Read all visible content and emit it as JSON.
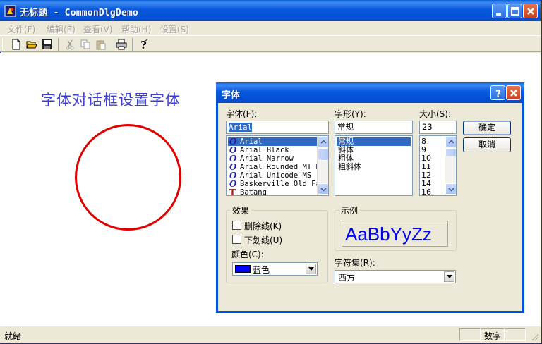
{
  "window": {
    "title": "无标题 - CommonDlgDemo"
  },
  "menu": [
    "文件(F)",
    "编辑(E)",
    "查看(V)",
    "帮助(H)",
    "设置(S)"
  ],
  "toolbar": {
    "icons": [
      "new-file-icon",
      "open-folder-icon",
      "save-icon",
      "cut-icon",
      "copy-icon",
      "paste-icon",
      "print-icon",
      "help-icon"
    ]
  },
  "canvas": {
    "text": "字体对话框设置字体",
    "text_color": "#3c3cd0",
    "circle_color": "#e00000"
  },
  "status": {
    "text": "就绪",
    "panes": [
      "",
      "数字",
      ""
    ]
  },
  "font_dialog": {
    "title": "字体",
    "font_label": "字体(F):",
    "font_value": "Arial",
    "fonts": [
      {
        "name": "Arial",
        "type": "O",
        "selected": true
      },
      {
        "name": "Arial Black",
        "type": "O",
        "selected": false
      },
      {
        "name": "Arial Narrow",
        "type": "O",
        "selected": false
      },
      {
        "name": "Arial Rounded MT B",
        "type": "O",
        "selected": false
      },
      {
        "name": "Arial Unicode MS",
        "type": "O",
        "selected": false
      },
      {
        "name": "Baskerville Old Fa",
        "type": "O",
        "selected": false
      },
      {
        "name": "Batang",
        "type": "T",
        "selected": false
      }
    ],
    "style_label": "字形(Y):",
    "style_value": "常规",
    "styles": [
      {
        "name": "常规",
        "selected": true
      },
      {
        "name": "斜体",
        "selected": false
      },
      {
        "name": "粗体",
        "selected": false
      },
      {
        "name": "粗斜体",
        "selected": false
      }
    ],
    "size_label": "大小(S):",
    "size_value": "23",
    "sizes": [
      {
        "name": "8"
      },
      {
        "name": "9"
      },
      {
        "name": "10"
      },
      {
        "name": "11"
      },
      {
        "name": "12"
      },
      {
        "name": "14"
      },
      {
        "name": "16"
      }
    ],
    "ok_label": "确定",
    "cancel_label": "取消",
    "effects_title": "效果",
    "strikeout_label": "删除线(K)",
    "underline_label": "下划线(U)",
    "color_label": "颜色(C):",
    "color_value": "蓝色",
    "color_swatch": "#0000ff",
    "sample_title": "示例",
    "sample_text": "AaBbYyZz",
    "charset_label": "字符集(R):",
    "charset_value": "西方"
  }
}
